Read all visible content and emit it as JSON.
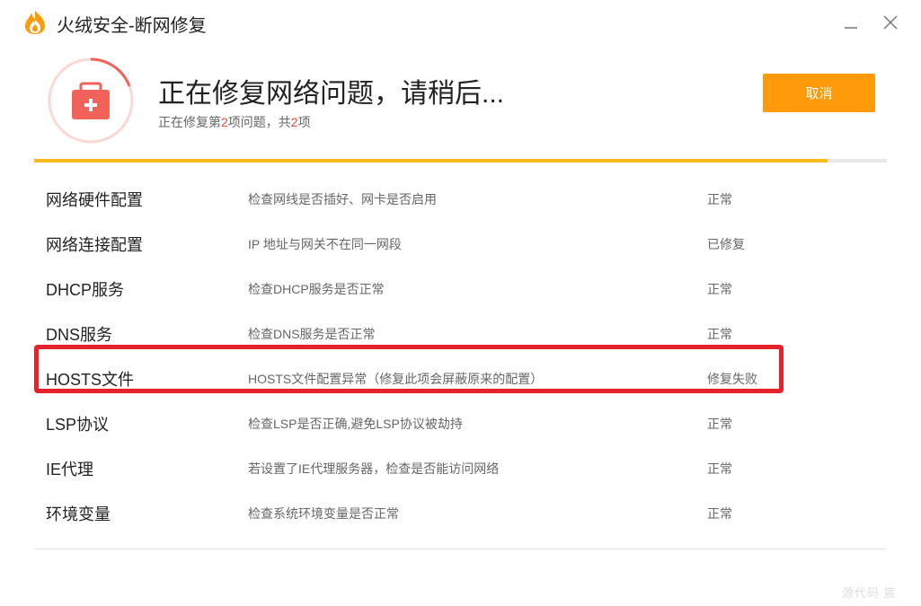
{
  "app": {
    "title": "火绒安全-断网修复"
  },
  "header": {
    "title": "正在修复网络问题，请稍后...",
    "sub_prefix": "正在修复第",
    "current": "2",
    "sub_middle": "项问题，共",
    "total": "2",
    "sub_suffix": "项",
    "icon": "first-aid-kit-icon"
  },
  "cancel_label": "取消",
  "progress": {
    "fraction": 0.93
  },
  "items": [
    {
      "name": "网络硬件配置",
      "desc": "检查网线是否插好、网卡是否启用",
      "status": "正常"
    },
    {
      "name": "网络连接配置",
      "desc": "IP 地址与网关不在同一网段",
      "status": "已修复"
    },
    {
      "name": "DHCP服务",
      "desc": "检查DHCP服务是否正常",
      "status": "正常"
    },
    {
      "name": "DNS服务",
      "desc": "检查DNS服务是否正常",
      "status": "正常"
    },
    {
      "name": "HOSTS文件",
      "desc": "HOSTS文件配置异常（修复此项会屏蔽原来的配置）",
      "status": "修复失败"
    },
    {
      "name": "LSP协议",
      "desc": "检查LSP是否正确,避免LSP协议被劫持",
      "status": "正常"
    },
    {
      "name": "IE代理",
      "desc": "若设置了IE代理服务器，检查是否能访问网络",
      "status": "正常"
    },
    {
      "name": "环境变量",
      "desc": "检查系统环境变量是否正常",
      "status": "正常"
    }
  ],
  "watermark": "源代码   宸",
  "colors": {
    "accent": "#ff9b0a",
    "progress": "#ffb81a",
    "icon_red": "#f0625a",
    "highlight": "#e5222c"
  }
}
